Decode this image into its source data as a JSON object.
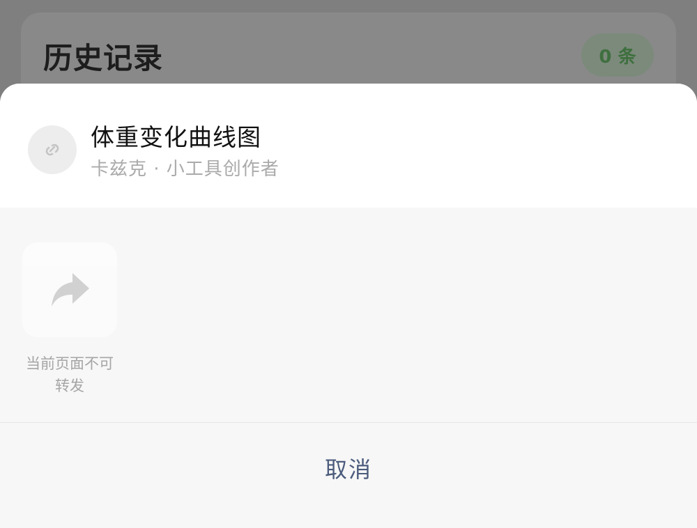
{
  "background_page": {
    "title": "历史记录",
    "count_badge": "0 条"
  },
  "sheet": {
    "app_name": "体重变化曲线图",
    "app_subtitle": "卡兹克 · 小工具创作者",
    "app_icon": "mini-program-link-icon",
    "share_action": {
      "icon": "share-forward-icon",
      "label_line1": "当前页面不可",
      "label_line2": "转发"
    },
    "cancel_label": "取消"
  },
  "colors": {
    "overlay_dim": "#7f7f7f",
    "sheet_header_bg": "#ffffff",
    "sheet_body_bg": "#f7f7f7",
    "cancel_text": "#4b5b7c",
    "badge_text": "#3f6f3f"
  }
}
